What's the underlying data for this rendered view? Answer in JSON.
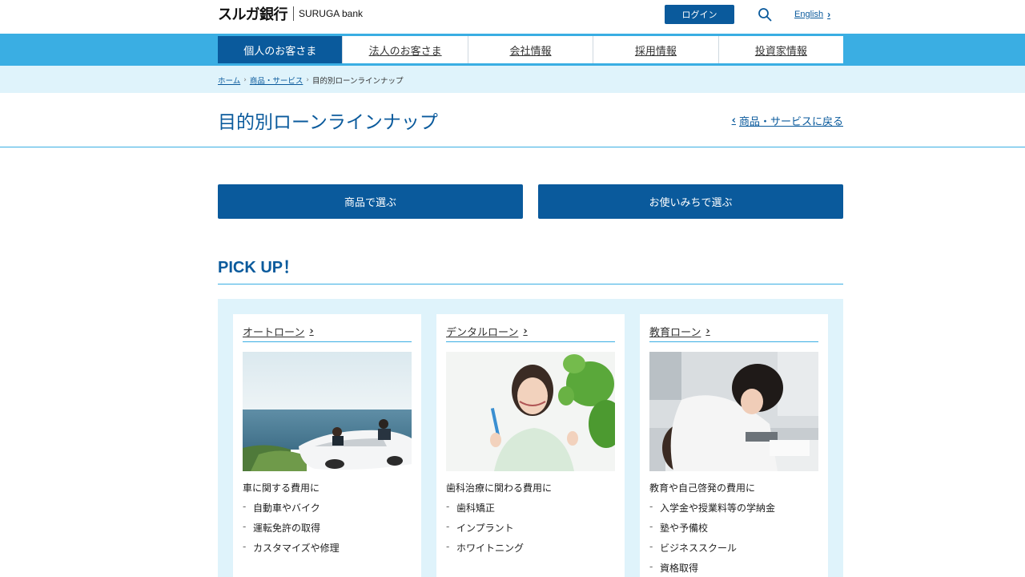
{
  "header": {
    "logo_jp": "スルガ銀行",
    "logo_en": "SURUGA bank",
    "login_label": "ログイン",
    "english_label": "English",
    "icons": {
      "search": "search-icon",
      "english_chevron": "chevron-right-icon"
    }
  },
  "gnav": {
    "items": [
      {
        "label": "個人のお客さま",
        "active": true
      },
      {
        "label": "法人のお客さま",
        "active": false
      },
      {
        "label": "会社情報",
        "active": false
      },
      {
        "label": "採用情報",
        "active": false
      },
      {
        "label": "投資家情報",
        "active": false
      }
    ]
  },
  "breadcrumb": {
    "items": [
      "ホーム",
      "商品・サービス",
      "目的別ローンラインナップ"
    ],
    "separator": "›"
  },
  "page": {
    "title": "目的別ローンラインナップ",
    "back_label": "商品・サービスに戻る"
  },
  "selectors": {
    "by_product": "商品で選ぶ",
    "by_usage": "お使いみちで選ぶ"
  },
  "pickup": {
    "title": "PICK UP！",
    "cards": [
      {
        "title": "オートローン",
        "image": "convertible-car-by-sea",
        "desc": "車に関する費用に",
        "items": [
          "自動車やバイク",
          "運転免許の取得",
          "カスタマイズや修理"
        ]
      },
      {
        "title": "デンタルローン",
        "image": "smiling-woman-with-toothbrush",
        "desc": "歯科治療に関わる費用に",
        "items": [
          "歯科矯正",
          "インプラント",
          "ホワイトニング"
        ]
      },
      {
        "title": "教育ローン",
        "image": "student-studying-at-desk",
        "desc": "教育や自己啓発の費用に",
        "items": [
          "入学金や授業料等の学納金",
          "塾や予備校",
          "ビジネススクール",
          "資格取得"
        ]
      }
    ]
  },
  "colors": {
    "brand_blue": "#0a5a9c",
    "nav_band": "#3aaee3",
    "light_band": "#dff3fb"
  }
}
